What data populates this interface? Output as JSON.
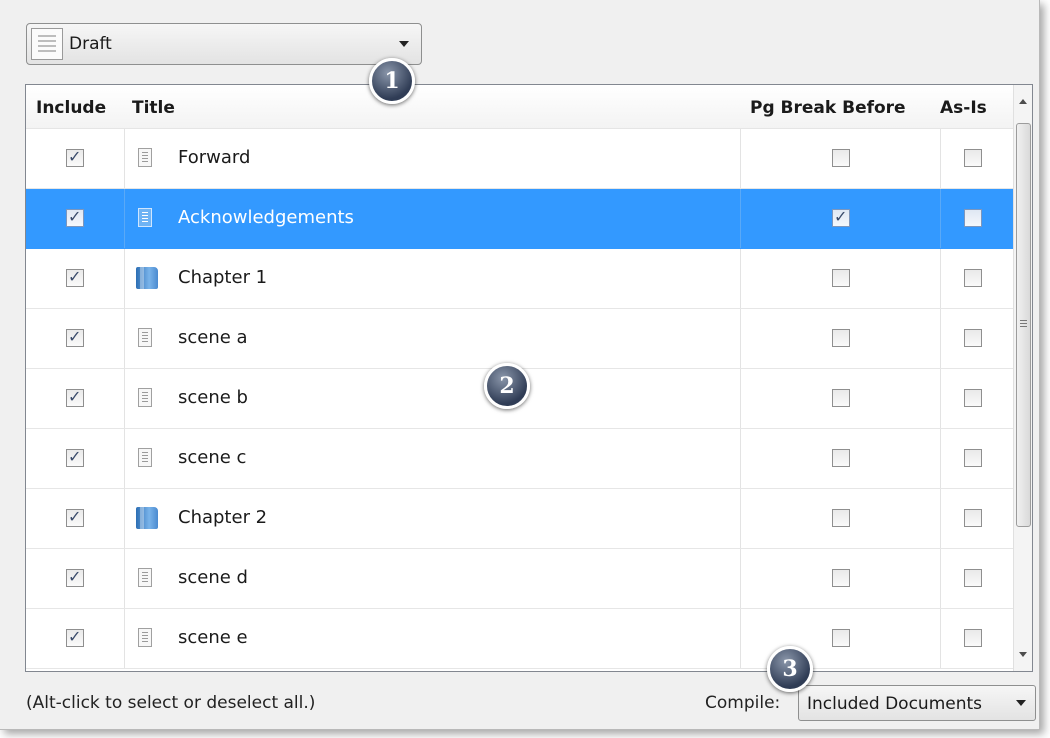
{
  "source": {
    "selected": "Draft"
  },
  "table": {
    "headers": {
      "include": "Include",
      "title": "Title",
      "pg_break": "Pg Break Before",
      "as_is": "As-Is"
    },
    "rows": [
      {
        "include": true,
        "title": "Forward",
        "icon": "document-icon",
        "pg_break": false,
        "as_is": false,
        "selected": false
      },
      {
        "include": true,
        "title": "Acknowledgements",
        "icon": "document-icon",
        "pg_break": true,
        "as_is": false,
        "selected": true
      },
      {
        "include": true,
        "title": "Chapter 1",
        "icon": "folder-icon",
        "pg_break": false,
        "as_is": false,
        "selected": false
      },
      {
        "include": true,
        "title": "scene a",
        "icon": "document-icon",
        "pg_break": false,
        "as_is": false,
        "selected": false
      },
      {
        "include": true,
        "title": "scene b",
        "icon": "document-icon",
        "pg_break": false,
        "as_is": false,
        "selected": false
      },
      {
        "include": true,
        "title": "scene c",
        "icon": "document-icon",
        "pg_break": false,
        "as_is": false,
        "selected": false
      },
      {
        "include": true,
        "title": "Chapter 2",
        "icon": "folder-icon",
        "pg_break": false,
        "as_is": false,
        "selected": false
      },
      {
        "include": true,
        "title": "scene d",
        "icon": "document-icon",
        "pg_break": false,
        "as_is": false,
        "selected": false
      },
      {
        "include": true,
        "title": "scene e",
        "icon": "document-icon",
        "pg_break": false,
        "as_is": false,
        "selected": false
      }
    ]
  },
  "footer": {
    "hint": "(Alt-click to select or deselect all.)",
    "compile_label": "Compile:",
    "compile_value": "Included Documents"
  },
  "badges": [
    "1",
    "2",
    "3"
  ],
  "colors": {
    "selection": "#3399ff",
    "badge": "#2f3c55"
  }
}
